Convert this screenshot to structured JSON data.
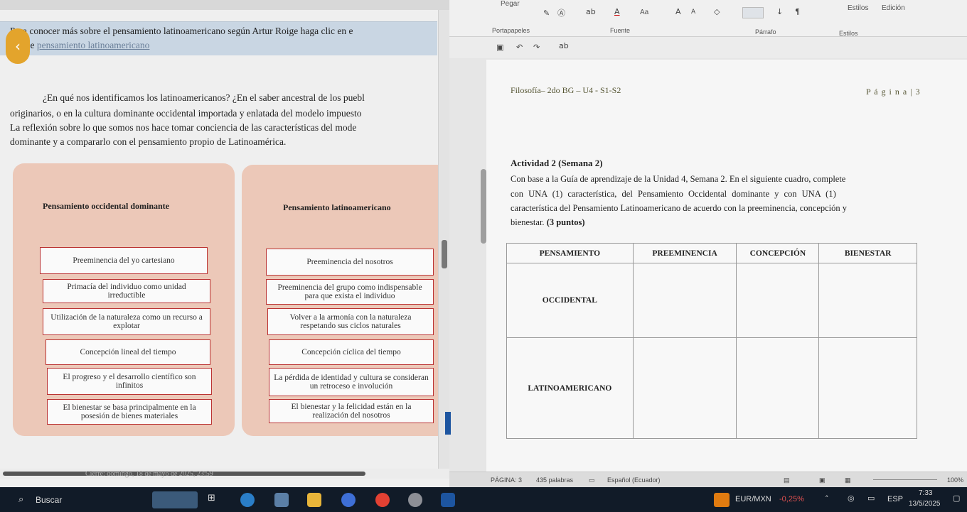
{
  "ribbon": {
    "paste": "Pegar",
    "clipboard": "Portapapeles",
    "font": "Fuente",
    "paragraph": "Párrafo",
    "styles_group": "Estilos",
    "styles_btn": "Estilos",
    "editing": "Edición",
    "font_size_label": "Aa"
  },
  "word_doc": {
    "header_left": "Filosofía– 2do BG – U4 - S1-S2",
    "header_right": "P á g i n a | 3",
    "activity_title": "Actividad 2 (Semana 2)",
    "instructions_1": "Con base a la Guía de aprendizaje de la Unidad 4, Semana 2. En el siguiente cuadro, complete",
    "instructions_2": "con UNA (1) característica, del Pensamiento Occidental dominante y con UNA (1)",
    "instructions_3": "característica del Pensamiento Latinoamericano de acuerdo con la preeminencia, concepción y",
    "instructions_4": "bienestar.",
    "points": "(3 puntos)",
    "table": {
      "headers": [
        "PENSAMIENTO",
        "PREEMINENCIA",
        "CONCEPCIÓN",
        "BIENESTAR"
      ],
      "rows": [
        "OCCIDENTAL",
        "LATINOAMERICANO"
      ]
    }
  },
  "statusbar": {
    "page": "PÁGINA: 3",
    "words": "435 palabras",
    "language": "Español (Ecuador)",
    "zoom": "100%"
  },
  "left_doc": {
    "link_text_1": "Para conocer más sobre el pensamiento latinoamericano según Artur Roige haga clic en e",
    "link_text_2": "enlace",
    "link": "pensamiento latinoamericano",
    "para_1": "¿En qué nos identificamos los latinoamericanos? ¿En el saber ancestral de los puebl",
    "para_2": "originarios, o en la cultura dominante occidental importada y enlatada del modelo impuesto",
    "para_3": "La reflexión sobre lo que somos nos hace tomar conciencia de las características del mode",
    "para_4": "dominante y a compararlo con el pensamiento propio de Latinoamérica.",
    "western_title": "Pensamiento occidental dominante",
    "latam_title": "Pensamiento latinoamericano",
    "western_items": [
      "Preeminencia del yo cartesiano",
      "Primacía del individuo como unidad irreductible",
      "Utilización de la naturaleza como un recurso a explotar",
      "Concepción lineal del tiempo",
      "El progreso y el desarrollo científico son infinitos",
      "El bienestar se basa principalmente en la posesión de bienes materiales"
    ],
    "latam_items": [
      "Preeminencia del nosotros",
      "Preeminencia del grupo como indispensable para que exista el individuo",
      "Volver a la armonía con la naturaleza respetando sus ciclos naturales",
      "Concepción cíclica del tiempo",
      "La pérdida de identidad y cultura se consideran un retroceso e involución",
      "El bienestar y la felicidad están en la realización del nosotros"
    ],
    "footer_blur": "Cierre: domingo, 18 de mayo de 2025, 23:59"
  },
  "taskbar": {
    "search_placeholder": "Buscar",
    "currency": "EUR/MXN",
    "currency_change": "-0,25%",
    "lang": "ESP",
    "time": "7:33",
    "date": "13/5/2025"
  },
  "colors": {
    "panel": "#ecc8b8",
    "box_border": "#b33333",
    "accent_orange": "#e3a42c",
    "taskbar": "#111b28",
    "word_blue": "#1d55a0"
  }
}
